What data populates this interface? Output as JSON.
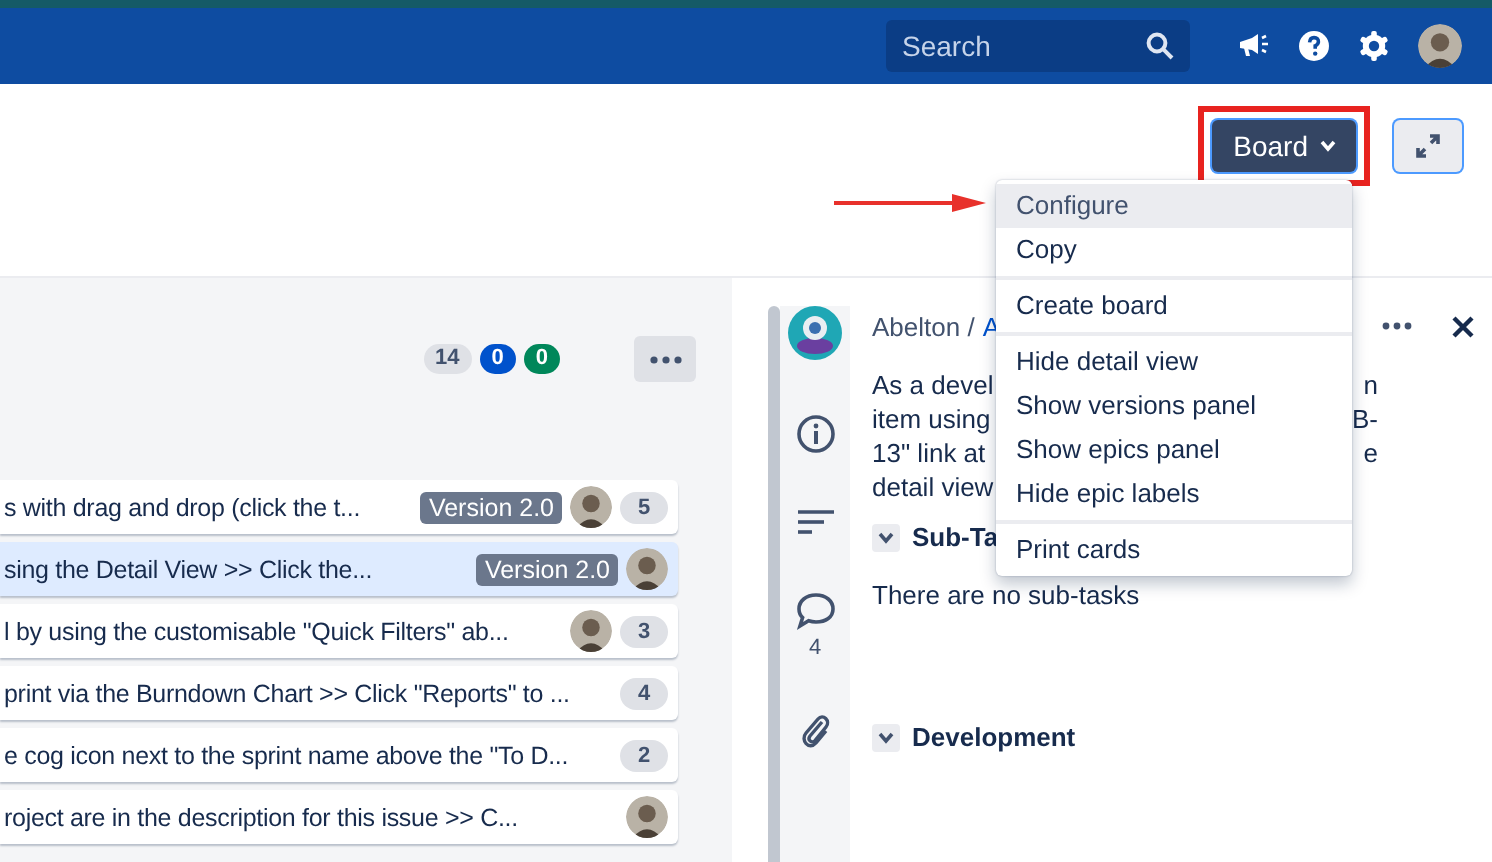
{
  "header": {
    "search": {
      "placeholder": "Search"
    }
  },
  "toolbar": {
    "board_button": {
      "label": "Board"
    }
  },
  "board_menu": {
    "groups": [
      {
        "items": [
          {
            "label": "Configure",
            "selected": true
          },
          {
            "label": "Copy",
            "selected": false
          }
        ]
      },
      {
        "items": [
          {
            "label": "Create board",
            "selected": false
          }
        ]
      },
      {
        "items": [
          {
            "label": "Hide detail view",
            "selected": false
          },
          {
            "label": "Show versions panel",
            "selected": false
          },
          {
            "label": "Show epics panel",
            "selected": false
          },
          {
            "label": "Hide epic labels",
            "selected": false
          }
        ]
      },
      {
        "items": [
          {
            "label": "Print cards",
            "selected": false
          }
        ]
      }
    ]
  },
  "column": {
    "counts": [
      {
        "text": "14",
        "color": "#dfe1e6"
      },
      {
        "text": "0",
        "color": "#0052cc"
      },
      {
        "text": "0",
        "color": "#00875a"
      }
    ],
    "cards": [
      {
        "text": "s with drag and drop (click the t...",
        "version": "Version 2.0",
        "assignee": true,
        "estimate": "5",
        "selected": false
      },
      {
        "text": "sing the Detail View >> Click the...",
        "version": "Version 2.0",
        "assignee": true,
        "selected": true
      },
      {
        "text": "l by using the customisable \"Quick Filters\" ab...",
        "assignee": true,
        "estimate": "3",
        "selected": false
      },
      {
        "text": "print via the Burndown Chart >> Click \"Reports\" to ...",
        "assignee": false,
        "estimate": "4",
        "selected": false
      },
      {
        "text": "e cog icon next to the sprint name above the \"To D...",
        "assignee": false,
        "estimate": "2",
        "selected": false
      },
      {
        "text": "roject are in the description for this issue >> C...",
        "assignee": true,
        "selected": false
      }
    ]
  },
  "detail": {
    "comment_count": "4",
    "breadcrumb": {
      "project": "Abelton /",
      "issue": "A"
    },
    "description_lines": [
      {
        "left": "As a devel",
        "right": "n"
      },
      {
        "left": "item using",
        "right": "B-"
      },
      {
        "left": "13\" link at",
        "right": "e"
      },
      {
        "left": "detail view"
      }
    ],
    "sections": [
      {
        "title": "Sub-Ta",
        "expanded": true,
        "body": "There are no sub-tasks"
      },
      {
        "title": "Development",
        "expanded": true
      }
    ]
  }
}
